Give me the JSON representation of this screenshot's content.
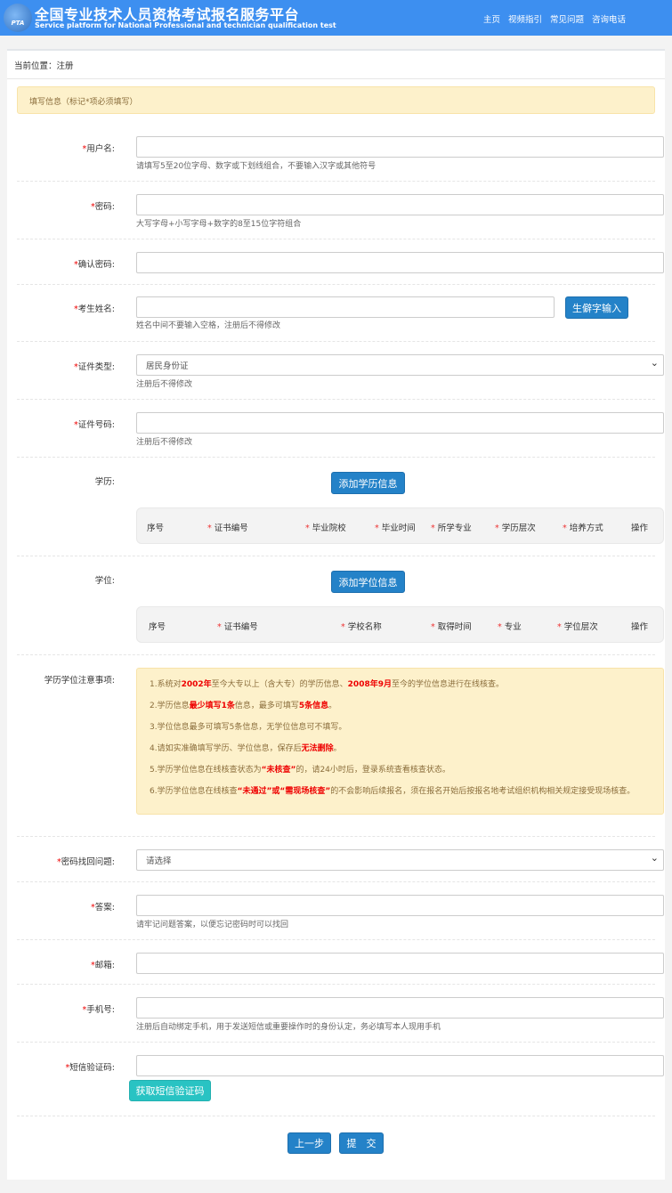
{
  "header": {
    "title": "全国专业技术人员资格考试报名服务平台",
    "subtitle": "Service platform for National Professional and technician qualification test",
    "logo_text": "PTA",
    "nav": [
      "主页",
      "视频指引",
      "常见问题",
      "咨询电话"
    ]
  },
  "breadcrumb": "当前位置：注册",
  "notice": "填写信息（标记*项必须填写）",
  "form": {
    "username": {
      "label": "用户名:",
      "hint": "请填写5至20位字母、数字或下划线组合，不要输入汉字或其他符号",
      "value": ""
    },
    "password": {
      "label": "密码:",
      "hint": "大写字母+小写字母+数字的8至15位字符组合",
      "value": ""
    },
    "confirm": {
      "label": "确认密码:",
      "value": ""
    },
    "name": {
      "label": "考生姓名:",
      "hint": "姓名中间不要输入空格，注册后不得修改",
      "rare_button": "生僻字输入",
      "value": ""
    },
    "id_type": {
      "label": "证件类型:",
      "value": "居民身份证",
      "hint": "注册后不得修改"
    },
    "id_no": {
      "label": "证件号码:",
      "hint": "注册后不得修改",
      "value": ""
    },
    "education": {
      "label": "学历:",
      "add_button": "添加学历信息",
      "columns": [
        {
          "t": "序号",
          "req": false
        },
        {
          "t": "证书编号",
          "req": true
        },
        {
          "t": "毕业院校",
          "req": true
        },
        {
          "t": "毕业时间",
          "req": true
        },
        {
          "t": "所学专业",
          "req": true
        },
        {
          "t": "学历层次",
          "req": true
        },
        {
          "t": "培养方式",
          "req": true
        },
        {
          "t": "操作",
          "req": false
        }
      ]
    },
    "degree": {
      "label": "学位:",
      "add_button": "添加学位信息",
      "columns": [
        {
          "t": "序号",
          "req": false
        },
        {
          "t": "证书编号",
          "req": true
        },
        {
          "t": "学校名称",
          "req": true
        },
        {
          "t": "取得时间",
          "req": true
        },
        {
          "t": "专业",
          "req": true
        },
        {
          "t": "学位层次",
          "req": true
        },
        {
          "t": "操作",
          "req": false
        }
      ]
    },
    "notes": {
      "label": "学历学位注意事项:",
      "items": [
        [
          {
            "t": "1.系统对"
          },
          {
            "t": "2002年",
            "red": true
          },
          {
            "t": "至今大专以上（含大专）的学历信息、"
          },
          {
            "t": "2008年9月",
            "red": true
          },
          {
            "t": "至今的学位信息进行在线核查。"
          }
        ],
        [
          {
            "t": "2.学历信息"
          },
          {
            "t": "最少填写1条",
            "red": true
          },
          {
            "t": "信息，最多可填写"
          },
          {
            "t": "5条信息",
            "red": true
          },
          {
            "t": "。"
          }
        ],
        [
          {
            "t": "3.学位信息最多可填写5条信息，无学位信息可不填写。"
          }
        ],
        [
          {
            "t": "4.请如实准确填写学历、学位信息，保存后"
          },
          {
            "t": "无法删除",
            "red": true
          },
          {
            "t": "。"
          }
        ],
        [
          {
            "t": "5.学历学位信息在线核查状态为"
          },
          {
            "t": "“未核查”",
            "red": true
          },
          {
            "t": "的，请24小时后，登录系统查看核查状态。"
          }
        ],
        [
          {
            "t": "6.学历学位信息在线核查"
          },
          {
            "t": "“未通过”或“需现场核查”",
            "red": true
          },
          {
            "t": "的不会影响后续报名，须在报名开始后按报名地考试组织机构相关规定接受现场核查。"
          }
        ]
      ]
    },
    "question": {
      "label": "密码找回问题:",
      "value": "请选择"
    },
    "answer": {
      "label": "答案:",
      "hint": "请牢记问题答案，以便忘记密码时可以找回",
      "value": ""
    },
    "email": {
      "label": "邮箱:",
      "value": ""
    },
    "phone": {
      "label": "手机号:",
      "hint": "注册后自动绑定手机，用于发送短信或重要操作时的身份认定，务必填写本人现用手机",
      "value": ""
    },
    "sms": {
      "label": "短信验证码:",
      "get_button": "获取短信验证码",
      "value": ""
    }
  },
  "actions": {
    "prev": "上一步",
    "submit": "提　交"
  },
  "colors": {
    "header": "#3d8ff0",
    "button": "#2482c8",
    "sms_button": "#29c3c3",
    "notice_bg": "#fdf1cb",
    "required": "#ee0000"
  }
}
